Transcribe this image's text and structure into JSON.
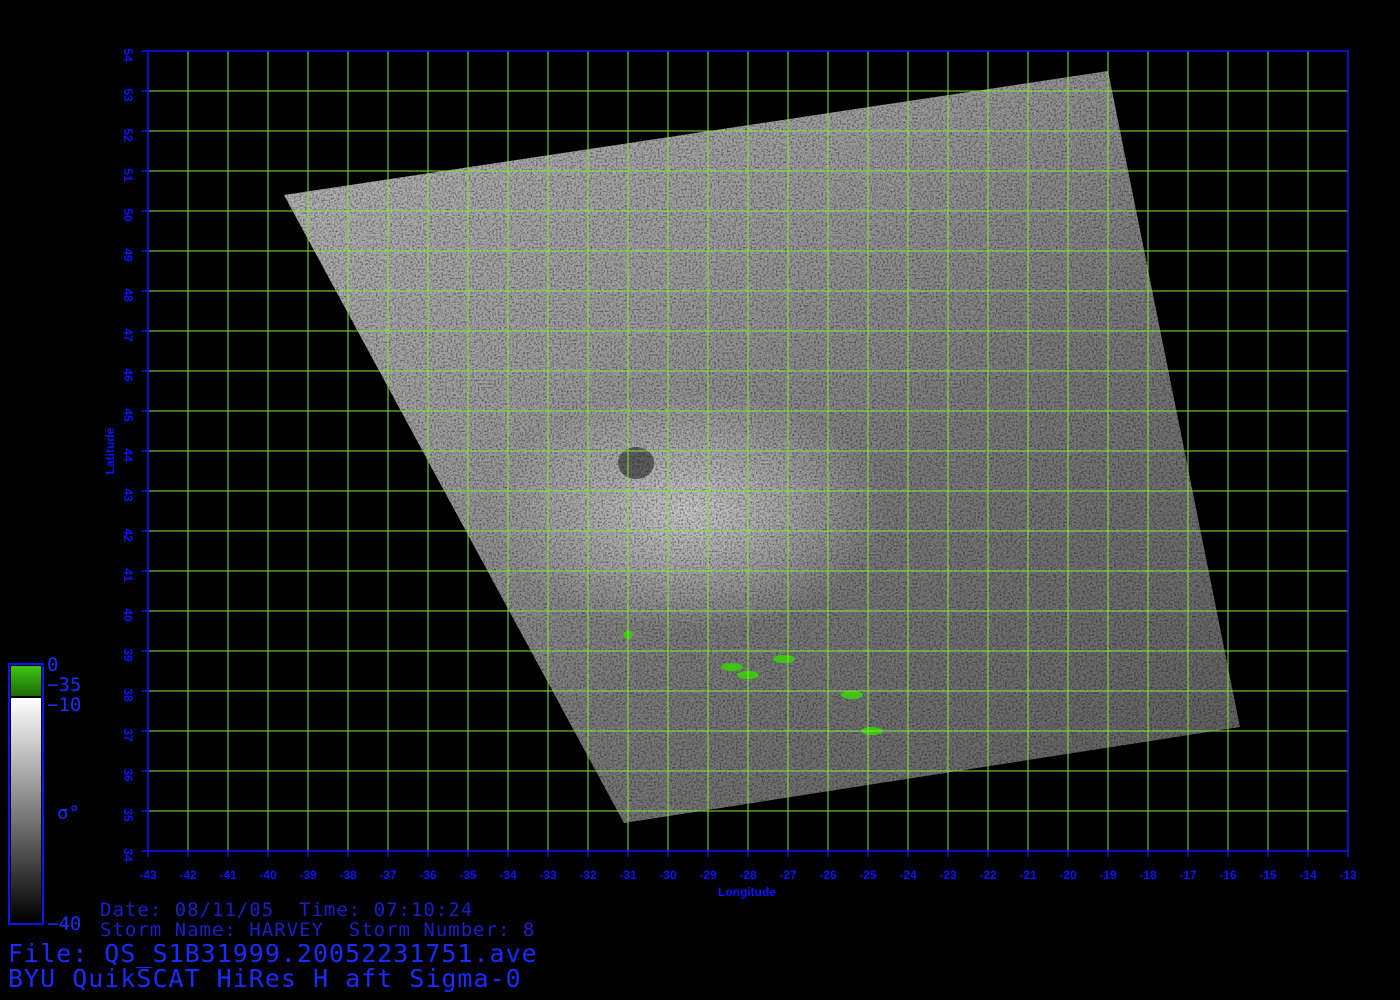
{
  "map": {
    "lon_range": [
      -43,
      -13
    ],
    "lat_range": [
      34,
      54
    ],
    "xlabel": "Longitude",
    "ylabel": "Latitude",
    "grid": true,
    "grid_color": "#7fe83a",
    "frame_color": "#0a14ff",
    "lon_ticks": [
      "-43",
      "-42",
      "-41",
      "-40",
      "-39",
      "-38",
      "-37",
      "-36",
      "-35",
      "-34",
      "-33",
      "-32",
      "-31",
      "-30",
      "-29",
      "-28",
      "-27",
      "-26",
      "-25",
      "-24",
      "-23",
      "-22",
      "-21",
      "-20",
      "-19",
      "-18",
      "-17",
      "-16",
      "-15",
      "-14",
      "-13"
    ],
    "lat_ticks": [
      "34",
      "35",
      "36",
      "37",
      "38",
      "39",
      "40",
      "41",
      "42",
      "43",
      "44",
      "45",
      "46",
      "47",
      "48",
      "49",
      "50",
      "51",
      "52",
      "53",
      "54"
    ],
    "swath_corners_lonlat": [
      [
        -39.6,
        50.4
      ],
      [
        -19.0,
        53.5
      ],
      [
        -15.7,
        37.1
      ],
      [
        -31.1,
        34.7
      ]
    ],
    "low_sigma_patches_lonlat": [
      [
        -31.0,
        39.4
      ],
      [
        -28.4,
        38.6
      ],
      [
        -28.0,
        38.4
      ],
      [
        -27.1,
        38.8
      ],
      [
        -25.4,
        37.9
      ],
      [
        -24.9,
        37.0
      ]
    ]
  },
  "colorbar": {
    "label_top": "0",
    "label_green_bottom": "−35",
    "label_gray_top": "−10",
    "label_symbol": "σ°",
    "label_bottom": "−40",
    "green_color": "#3fc413"
  },
  "info": {
    "date_line": "Date: 08/11/05  Time: 07:10:24",
    "storm_line": "Storm Name: HARVEY  Storm Number: 8",
    "file_line": "File: QS_S1B31999.20052231751.ave",
    "product_line": "BYU QuikSCAT HiRes H aft Sigma-0"
  },
  "colors": {
    "background": "#000000",
    "text": "#1a2cff"
  }
}
